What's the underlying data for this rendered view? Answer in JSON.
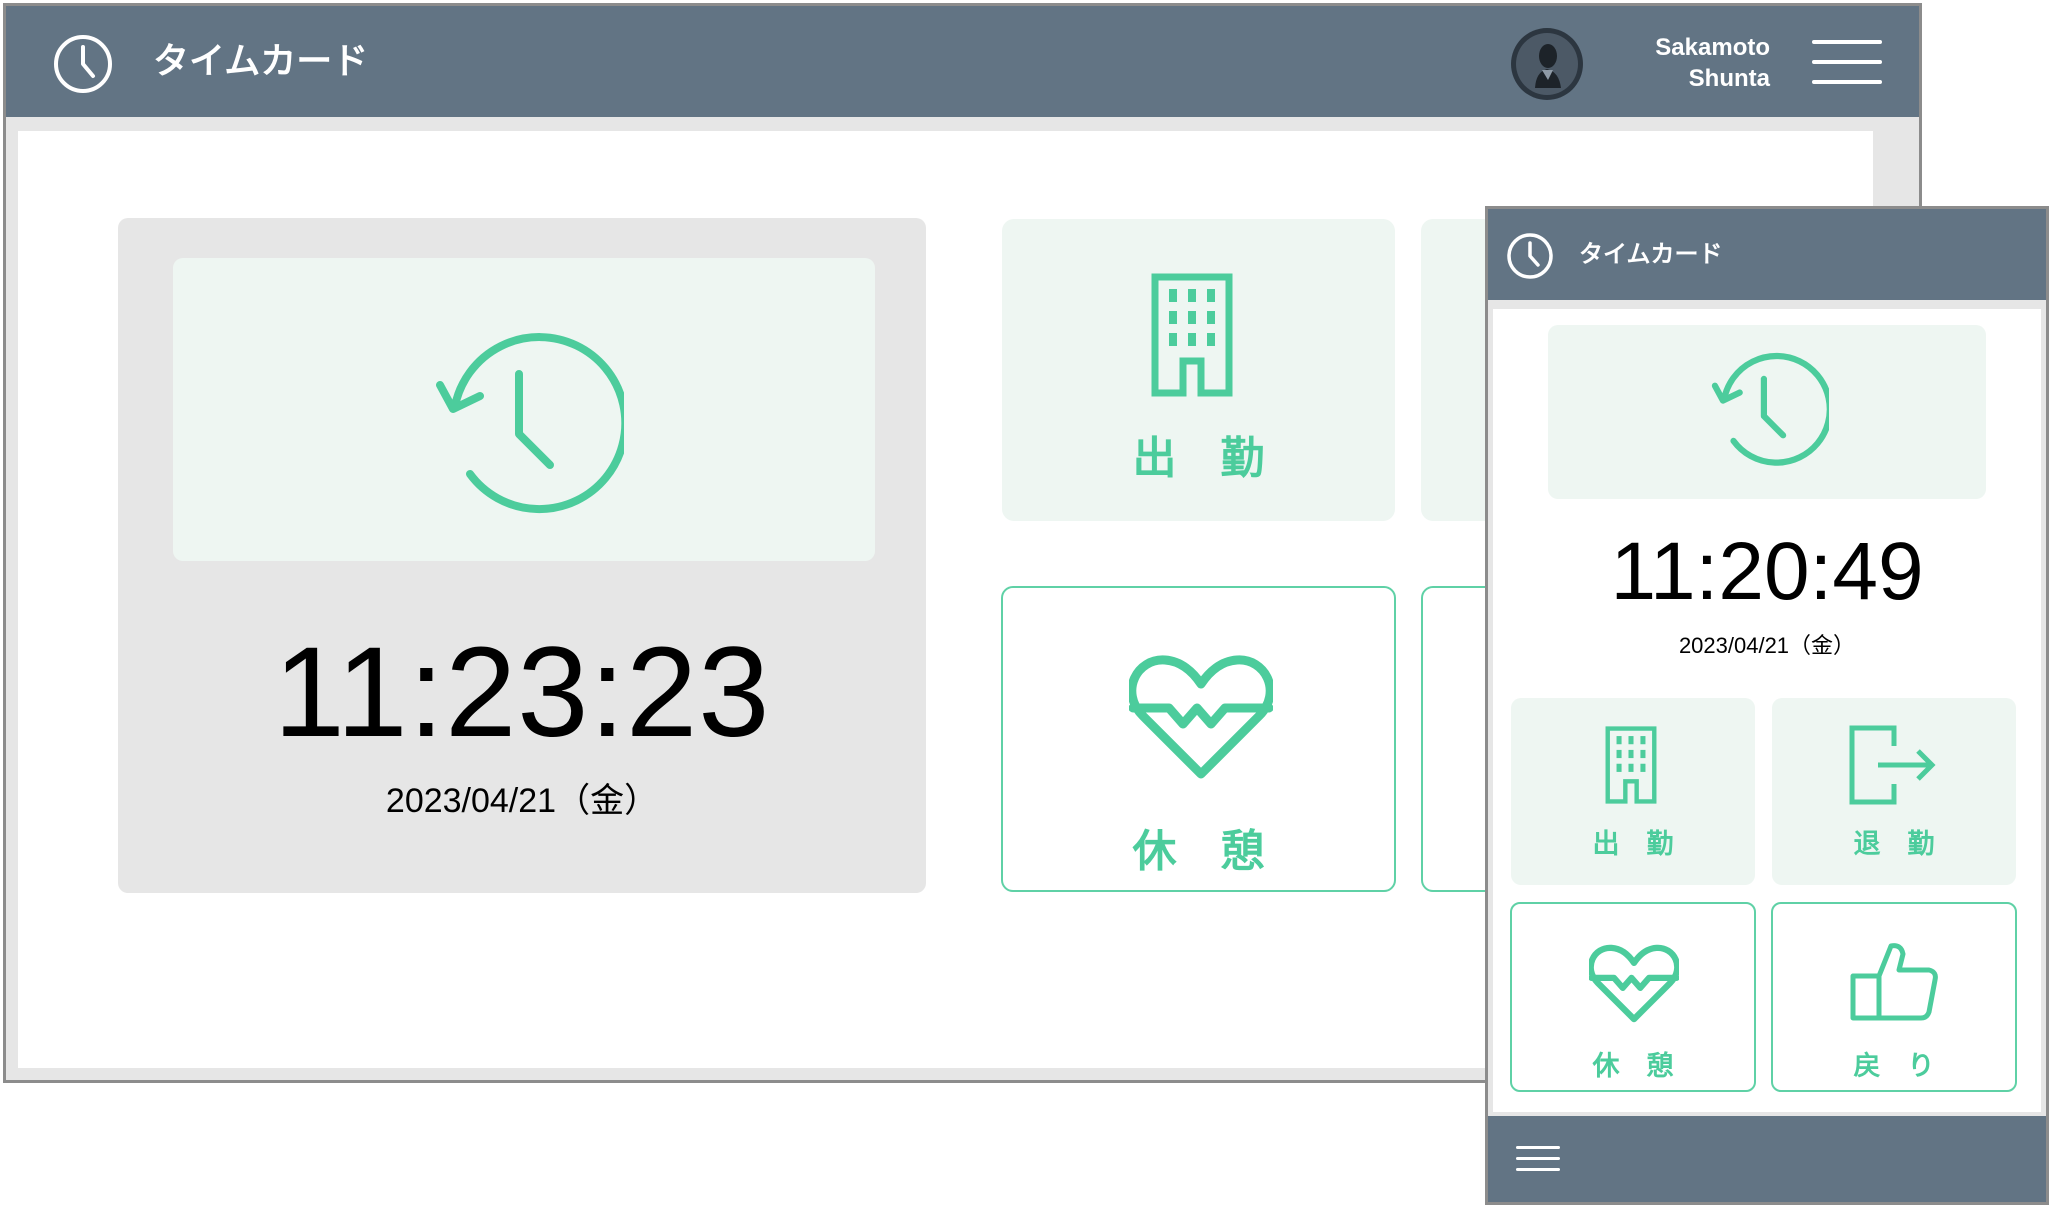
{
  "desktop": {
    "app_title": "タイムカード",
    "user": {
      "first_name": "Sakamoto",
      "last_name": "Shunta"
    },
    "clock": {
      "time": "11:23:23",
      "date": "2023/04/21（金）"
    },
    "tiles": {
      "clock_in": "出　勤",
      "break": "休　憩"
    }
  },
  "mobile": {
    "app_title": "タイムカード",
    "clock": {
      "time": "11:20:49",
      "date": "2023/04/21（金）"
    },
    "tiles": {
      "clock_in": "出　勤",
      "clock_out": "退　勤",
      "break": "休　憩",
      "return": "戻　り"
    }
  },
  "colors": {
    "header": "#627484",
    "accent": "#4ccc9c",
    "tile_bg": "#eef6f2",
    "panel_bg": "#e6e6e6"
  },
  "icons": [
    "clock-icon",
    "history-clock-icon",
    "building-icon",
    "heart-pulse-icon",
    "exit-icon",
    "thumbs-up-icon",
    "hamburger-menu-icon",
    "avatar"
  ]
}
